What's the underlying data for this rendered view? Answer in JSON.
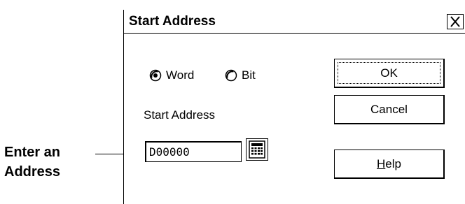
{
  "callout": {
    "line1": "Enter an",
    "line2": "Address"
  },
  "dialog": {
    "title": "Start Address",
    "close_glyph": "×",
    "radios": [
      {
        "label": "Word",
        "selected": true
      },
      {
        "label": "Bit",
        "selected": false
      }
    ],
    "field_label": "Start Address",
    "address_value": "D00000",
    "keypad_icon": "keypad-icon",
    "buttons": {
      "ok": "OK",
      "cancel": "Cancel",
      "help_hotkey": "H",
      "help_rest": "elp"
    }
  }
}
